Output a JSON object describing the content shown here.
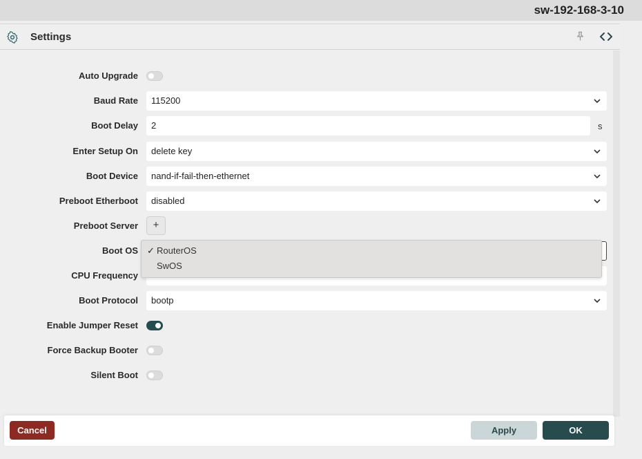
{
  "window": {
    "hostname": "sw-192-168-3-10"
  },
  "panel": {
    "title": "Settings"
  },
  "fields": {
    "auto_upgrade": {
      "label": "Auto Upgrade",
      "on": false
    },
    "baud_rate": {
      "label": "Baud Rate",
      "value": "115200"
    },
    "boot_delay": {
      "label": "Boot Delay",
      "value": "2",
      "unit": "s"
    },
    "enter_setup_on": {
      "label": "Enter Setup On",
      "value": "delete key"
    },
    "boot_device": {
      "label": "Boot Device",
      "value": "nand-if-fail-then-ethernet"
    },
    "preboot_etherboot": {
      "label": "Preboot Etherboot",
      "value": "disabled"
    },
    "preboot_server": {
      "label": "Preboot Server",
      "add_label": "+"
    },
    "boot_os": {
      "label": "Boot OS",
      "options": [
        "RouterOS",
        "SwOS"
      ],
      "selected": "RouterOS",
      "check": "✓"
    },
    "cpu_frequency": {
      "label": "CPU Frequency"
    },
    "boot_protocol": {
      "label": "Boot Protocol",
      "value": "bootp"
    },
    "enable_jumper_reset": {
      "label": "Enable Jumper Reset",
      "on": true
    },
    "force_backup_booter": {
      "label": "Force Backup Booter",
      "on": false
    },
    "silent_boot": {
      "label": "Silent Boot",
      "on": false
    }
  },
  "footer": {
    "cancel_label": "Cancel",
    "apply_label": "Apply",
    "ok_label": "OK"
  },
  "colors": {
    "accent": "#264c4e",
    "danger": "#8e2a22",
    "apply_bg": "#cbd6d8"
  },
  "icons": {
    "settings": "gear-icon",
    "pin": "pin-icon",
    "code": "code-icon",
    "chevron": "chevron-down-icon"
  }
}
